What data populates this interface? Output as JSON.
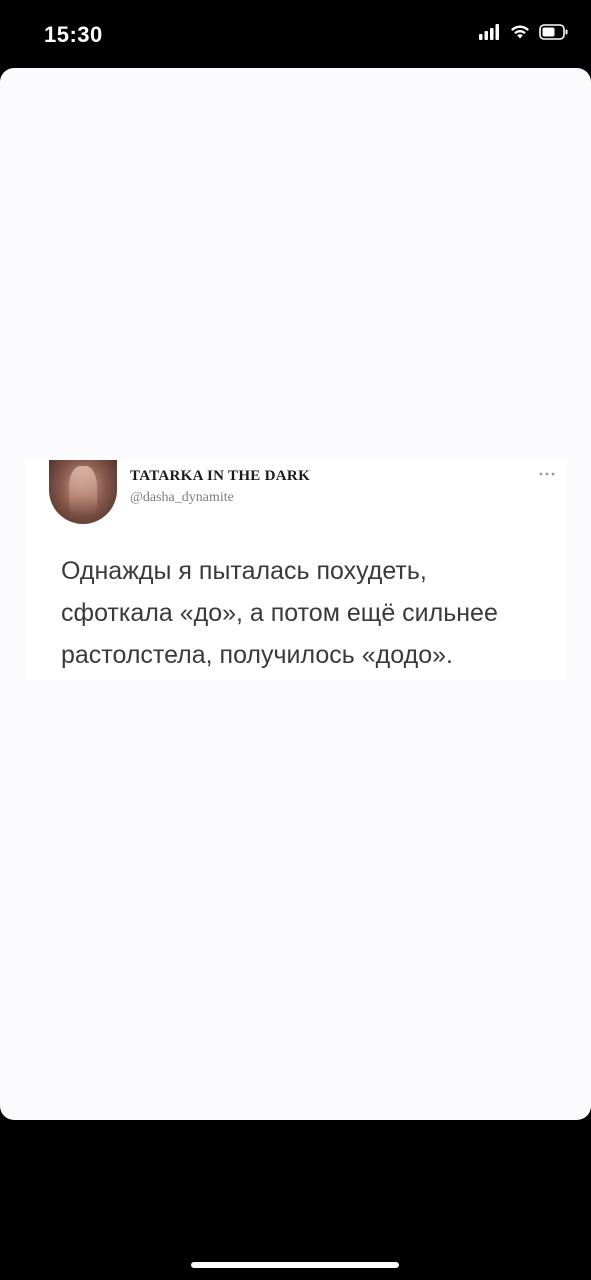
{
  "status_bar": {
    "time": "15:30",
    "icons": [
      "signal-icon",
      "wifi-icon",
      "battery-icon"
    ]
  },
  "tweet": {
    "display_name": "TATARKA IN THE DARK",
    "handle": "@dasha_dynamite",
    "more_icon": "more-icon",
    "text": "Однажды я пыталась похудеть,\nсфоткала «до», а потом ещё сильнее\nрастолстела, получилось «додо»."
  },
  "colors": {
    "background": "#000000",
    "sheet": "#fbfafc",
    "card": "#ffffff",
    "text": "#3a3a3a",
    "handle": "#7d7d7d"
  }
}
